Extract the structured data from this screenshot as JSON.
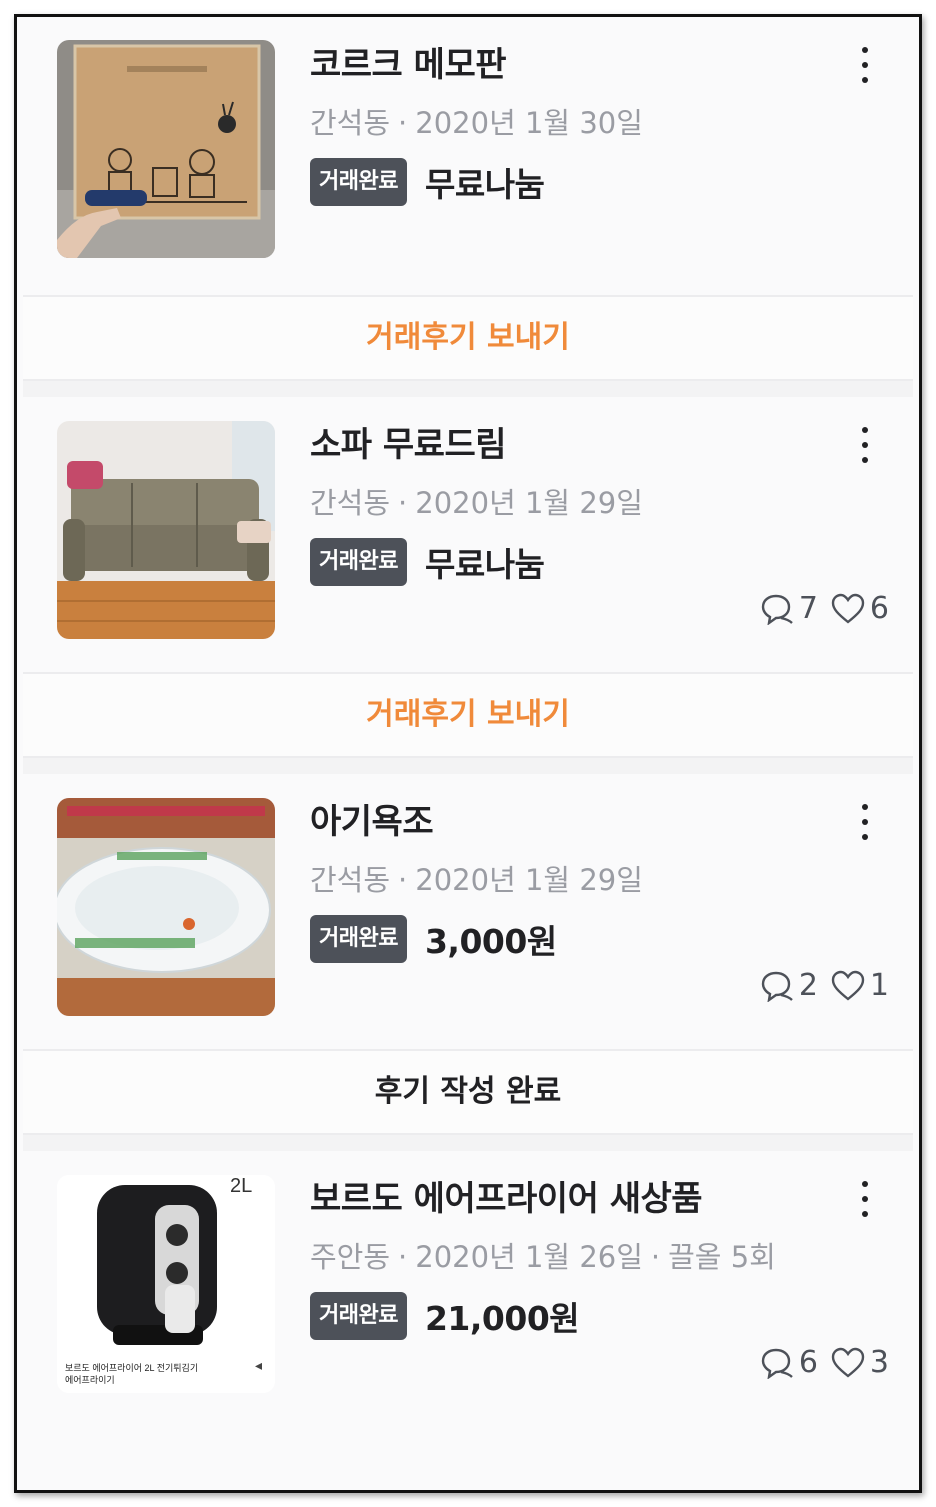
{
  "items": [
    {
      "title": "코르크 메모판",
      "location": "간석동",
      "date": "2020년 1월 30일",
      "extra": "",
      "status": "거래완료",
      "price": "무료나눔",
      "chat_count": "",
      "like_count": "",
      "action_label": "거래후기 보내기",
      "image": "cork-memo-board-photo"
    },
    {
      "title": "소파 무료드림",
      "location": "간석동",
      "date": "2020년 1월 29일",
      "extra": "",
      "status": "거래완료",
      "price": "무료나눔",
      "chat_count": "7",
      "like_count": "6",
      "action_label": "거래후기 보내기",
      "image": "sofa-photo"
    },
    {
      "title": "아기욕조",
      "location": "간석동",
      "date": "2020년 1월 29일",
      "extra": "",
      "status": "거래완료",
      "price": "3,000원",
      "chat_count": "2",
      "like_count": "1",
      "action_label": "후기 작성 완료",
      "image": "baby-bathtub-photo"
    },
    {
      "title": "보르도 에어프라이어 새상품",
      "location": "주안동",
      "date": "2020년 1월 26일",
      "extra": "끌올 5회",
      "status": "거래완료",
      "price": "21,000원",
      "chat_count": "6",
      "like_count": "3",
      "image": "air-fryer-photo",
      "image_caption_badge": "2L",
      "image_caption_line1": "보르도 에어프라이어 2L 전기튀김기",
      "image_caption_line2": "에어프라이기"
    }
  ],
  "colors": {
    "accent_orange": "#f08a3a",
    "badge_bg": "#4d5159",
    "meta_gray": "#9a9ca3"
  },
  "icons": {
    "more": "more-vertical-icon",
    "chat": "chat-bubbles-icon",
    "like": "heart-icon",
    "share": "share-icon"
  }
}
